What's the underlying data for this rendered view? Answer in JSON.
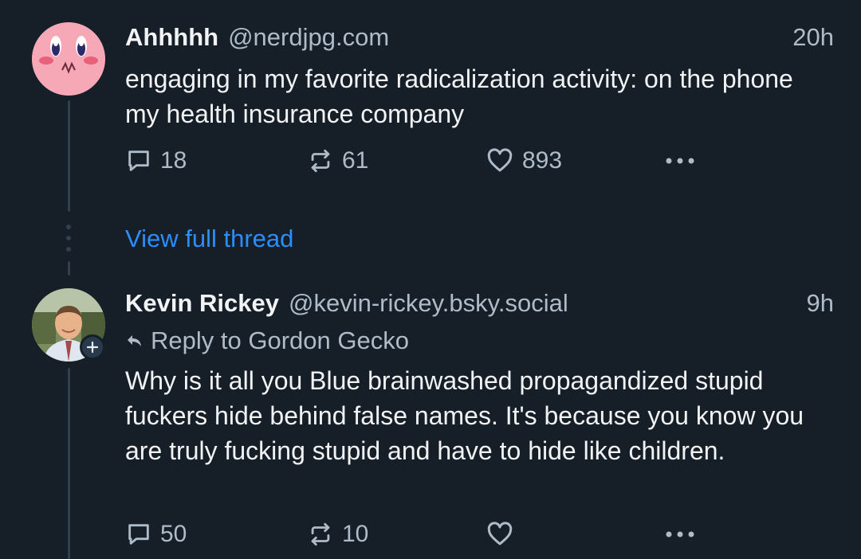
{
  "posts": [
    {
      "author_name": "Ahhhhh",
      "handle": "@nerdjpg.com",
      "time": "20h",
      "text": "engaging in my favorite radicalization activity: on the phone my health insurance company",
      "replies": "18",
      "reposts": "61",
      "likes": "893",
      "avatar_icon": "kirby-avatar"
    },
    {
      "author_name": "Kevin Rickey",
      "handle": "@kevin-rickey.bsky.social",
      "time": "9h",
      "reply_to": "Reply to Gordon Gecko",
      "text": "Why is it all you Blue brainwashed propagandized stupid fuckers hide behind false names.  It's because you know you are truly fucking stupid and have to hide like children.",
      "replies": "50",
      "reposts": "10",
      "likes": "",
      "avatar_icon": "person-photo-avatar"
    }
  ],
  "view_full_thread": "View full thread",
  "icons": {
    "reply": "speech-bubble-icon",
    "repost": "repost-arrows-icon",
    "like": "heart-icon",
    "more": "more-dots-icon",
    "follow": "plus-icon",
    "reply_arrow": "reply-arrow-icon"
  },
  "colors": {
    "background": "#161e27",
    "text": "#f1f3f5",
    "muted": "#aebbc9",
    "link": "#2a8eff",
    "thread_line": "#2e4052"
  }
}
